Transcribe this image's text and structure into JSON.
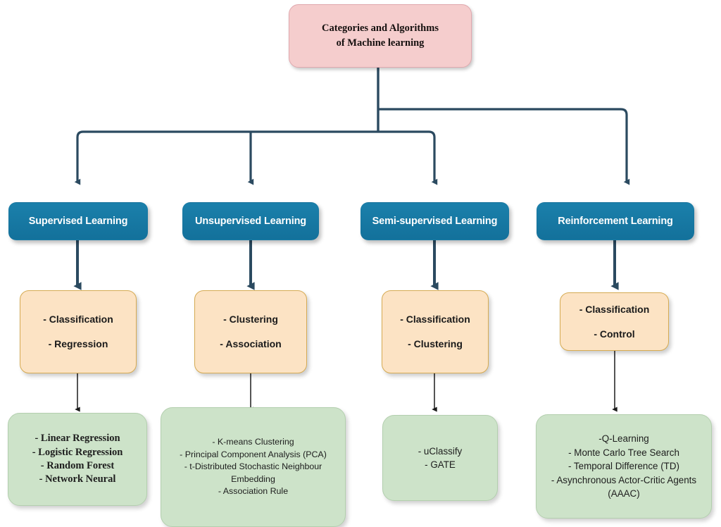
{
  "diagram": {
    "title": "Categories and Algorithms of Machine learning",
    "colors": {
      "root_fill": "#f5cdcd",
      "category_fill": "#1a7ba6",
      "task_fill": "#fce3c4",
      "algorithm_fill": "#cde3c9",
      "connector_primary": "#2b4a60",
      "connector_secondary": "#1a1a1a"
    }
  },
  "root": {
    "line1": "Categories and Algorithms",
    "line2": "of Machine learning"
  },
  "branches": [
    {
      "category": "Supervised Learning",
      "tasks": [
        "- Classification",
        "- Regression"
      ],
      "algorithms": [
        "- Linear Regression",
        "- Logistic Regression",
        "- Random Forest",
        "- Network Neural"
      ]
    },
    {
      "category": "Unsupervised Learning",
      "tasks": [
        "- Clustering",
        "- Association"
      ],
      "algorithms": [
        "- K-means Clustering",
        "- Principal Component Analysis (PCA)",
        "- t-Distributed Stochastic Neighbour",
        "Embedding",
        "- Association Rule"
      ]
    },
    {
      "category": "Semi-supervised Learning",
      "tasks": [
        "- Classification",
        "- Clustering"
      ],
      "algorithms": [
        "- uClassify",
        "- GATE"
      ]
    },
    {
      "category": "Reinforcement Learning",
      "tasks": [
        "- Classification",
        "- Control"
      ],
      "algorithms": [
        "-Q-Learning",
        "- Monte Carlo Tree Search",
        "- Temporal Difference (TD)",
        "- Asynchronous Actor-Critic Agents",
        "(AAAC)"
      ]
    }
  ]
}
